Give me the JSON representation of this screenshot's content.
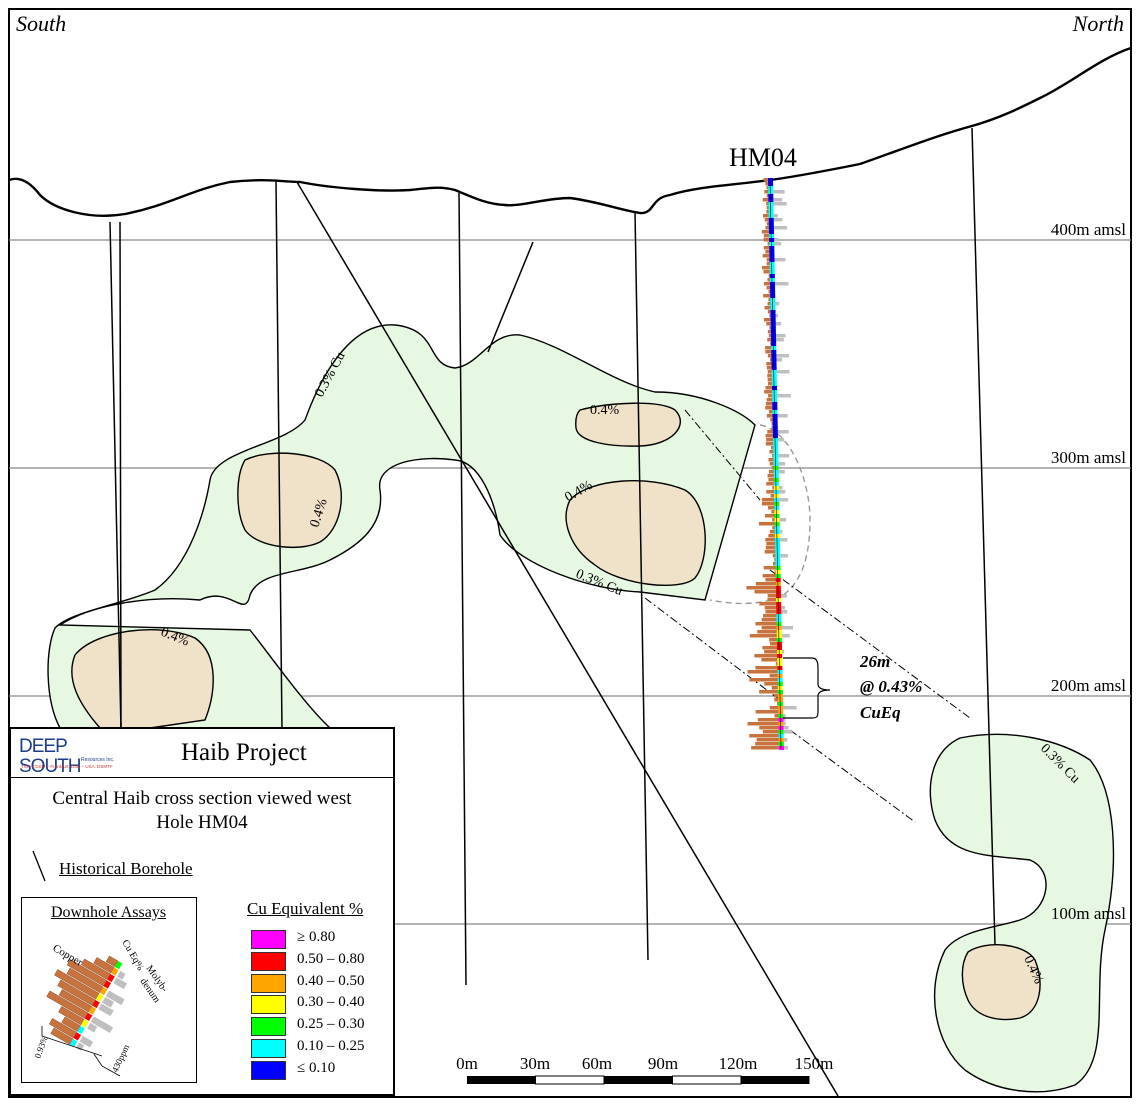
{
  "section": {
    "south_label": "South",
    "north_label": "North",
    "hole_label": "HM04",
    "elevations": [
      "400m amsl",
      "300m amsl",
      "200m amsl",
      "100m amsl"
    ],
    "contour_labels": {
      "cu_03_a": "0.3% Cu",
      "cu_03_b": "0.3% Cu",
      "cu_03_c": "0.3% Cu",
      "cu_04_a": "0.4%",
      "cu_04_b": "0.4%",
      "cu_04_c": "0.4%",
      "cu_04_d": "0.4%",
      "cu_04_e": "0.4%"
    },
    "intercept": {
      "line1": "26m",
      "line2": "@ 0.43%",
      "line3": "CuEq"
    },
    "scale_bar": [
      "0m",
      "30m",
      "60m",
      "90m",
      "120m",
      "150m"
    ],
    "colors": {
      "zone_03": "#e6f7e2",
      "zone_04": "#f0e1c9",
      "copper_bar": "#c8733e",
      "moly_bar": "#bfbfbf"
    }
  },
  "legend": {
    "logo_text": "DEEP SOUTH",
    "logo_sub": "Resources Inc.",
    "logo_exchanges": "TSX-V:DSM – Frankfurt: DSD – USA: DSMTF",
    "project_title": "Haib Project",
    "description_line1": "Central Haib cross section viewed west",
    "description_line2": "Hole HM04",
    "historical_label": "Historical Borehole",
    "assay_title": "Downhole Assays",
    "assay_labels": {
      "copper": "Copper",
      "cueq": "Cu Eq%",
      "moly": "Molyb-\ndenum",
      "cu_scale": "0.93%",
      "mo_scale": "430ppm"
    },
    "scale_title": "Cu Equivalent %",
    "scale": [
      {
        "label": "≥ 0.80",
        "color": "#ff00ff"
      },
      {
        "label": "0.50 – 0.80",
        "color": "#ff0000"
      },
      {
        "label": "0.40 – 0.50",
        "color": "#ffa500"
      },
      {
        "label": "0.30 – 0.40",
        "color": "#ffff00"
      },
      {
        "label": "0.25 – 0.30",
        "color": "#00ff00"
      },
      {
        "label": "0.10 – 0.25",
        "color": "#00ffff"
      },
      {
        "label": "≤ 0.10",
        "color": "#0000ff"
      }
    ]
  }
}
